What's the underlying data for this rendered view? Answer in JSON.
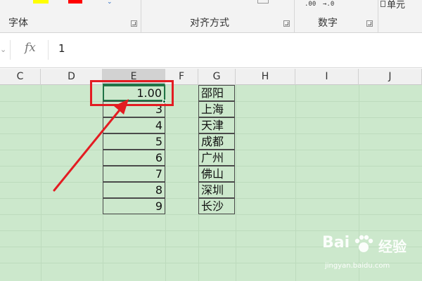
{
  "ribbon": {
    "groups": [
      {
        "label": "字体"
      },
      {
        "label": "对齐方式"
      },
      {
        "label": "数字"
      }
    ],
    "number_format_1": ".00",
    "number_format_2": "→.0",
    "cell_style_label": "单元"
  },
  "formula_bar": {
    "fx_label": "fx",
    "value": "1"
  },
  "columns": [
    "C",
    "D",
    "E",
    "F",
    "G",
    "H",
    "I",
    "J"
  ],
  "active_column": "E",
  "rows": [
    {
      "e": "1.00",
      "g": "邵阳"
    },
    {
      "e": "3",
      "g": "上海"
    },
    {
      "e": "4",
      "g": "天津"
    },
    {
      "e": "5",
      "g": "成都"
    },
    {
      "e": "6",
      "g": "广州"
    },
    {
      "e": "7",
      "g": "佛山"
    },
    {
      "e": "8",
      "g": "深圳"
    },
    {
      "e": "9",
      "g": "长沙"
    }
  ],
  "annotation": {
    "color": "#e31c22"
  },
  "watermark": {
    "brand": "Bai",
    "sub": "经验",
    "url": "jingyan.baidu.com"
  },
  "colors": {
    "sheet_background": "#cce8cc",
    "selection": "#217346",
    "annotation_red": "#e31c22"
  }
}
